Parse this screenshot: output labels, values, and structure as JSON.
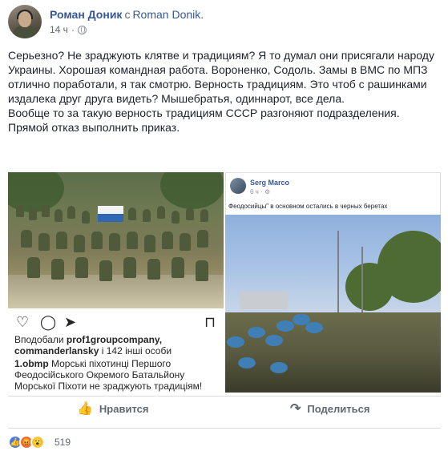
{
  "post": {
    "author": "Роман Доник",
    "with_text": "с",
    "coauthor": "Roman Donik.",
    "time": "14 ч",
    "separator": "·",
    "paragraphs": [
      "Серьезно? Не зраджують клятве и традициям? Я то думал они присягали народу Украины. Хорошая командная работа. Вороненко, Содоль. Замы в ВМС по МПЗ отлично поработали, я так смотрю. Верность традициям. Это чтоб с рашинками издалека друг друга видеть? Мышебратья, одиннарот, все дела.",
      "Вообще то за такую верность традициям СССР разгоняют подразделения. Прямой отказ выполнить приказ."
    ]
  },
  "instagram": {
    "likes_prefix": "Вподобали ",
    "liker1": "prof1groupcompany,",
    "liker2": "commanderlansky",
    "likes_suffix": " і 142 інші особи",
    "caption_user": "1.obmp",
    "caption_text": " Морські піхотинці Першого Феодосійського Окремого Батальйону Морської Піхоти не зраджують традиціям!",
    "icons": [
      "heart-icon",
      "comment-icon",
      "share-icon",
      "bookmark-icon"
    ]
  },
  "repost": {
    "name": "Serg Marco",
    "time": "6 ч · ⚙",
    "text": "Феодосийцы\" в основном остались в черных беретах"
  },
  "actions": {
    "like_label": "Нравится",
    "share_label": "Поделиться",
    "like_glyph": "👍",
    "share_glyph": "↷"
  },
  "reactions": {
    "count": "519",
    "types": [
      "like-icon",
      "angry-icon",
      "wow-icon"
    ],
    "glyphs": [
      "👍",
      "😡",
      "😮"
    ]
  },
  "colors": {
    "link": "#365899",
    "meta": "#616770",
    "like_blue": "#4a7bec"
  }
}
